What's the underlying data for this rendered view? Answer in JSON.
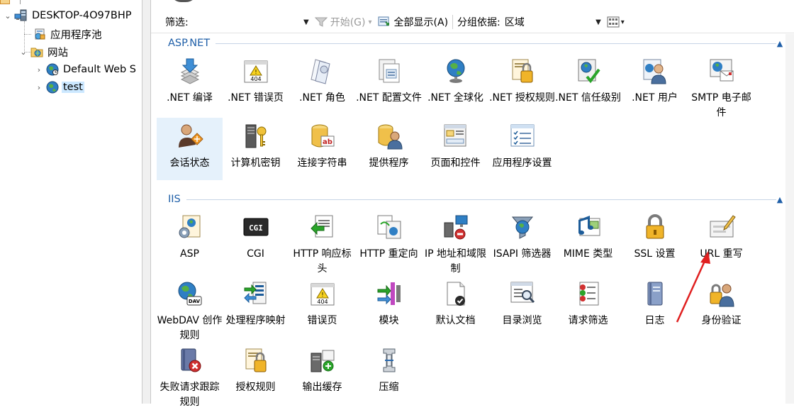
{
  "tree": {
    "items": [
      {
        "label": "DESKTOP-4O97BHP",
        "expanded": true
      },
      {
        "label": "应用程序池"
      },
      {
        "label": "网站",
        "expanded": true
      },
      {
        "label": "Default Web S"
      },
      {
        "label": "test",
        "selected": true
      }
    ]
  },
  "toolbar": {
    "filter_label": "筛选:",
    "filter_value": "",
    "go_label": "开始(G)",
    "show_all_label": "全部显示(A)",
    "group_by_label": "分组依据:",
    "group_by_value": "区域"
  },
  "sections": [
    {
      "title": "ASP.NET",
      "tiles": [
        {
          "label": ".NET 编译",
          "icon": "net-compile-icon"
        },
        {
          "label": ".NET 错误页",
          "icon": "net-error-pages-icon"
        },
        {
          "label": ".NET 角色",
          "icon": "net-roles-icon"
        },
        {
          "label": ".NET 配置文件",
          "icon": "net-profile-icon"
        },
        {
          "label": ".NET 全球化",
          "icon": "net-globalization-icon"
        },
        {
          "label": ".NET 授权规则",
          "icon": "net-authorization-icon"
        },
        {
          "label": ".NET 信任级别",
          "icon": "net-trust-levels-icon"
        },
        {
          "label": ".NET 用户",
          "icon": "net-users-icon"
        },
        {
          "label": "SMTP 电子邮件",
          "icon": "smtp-email-icon"
        },
        {
          "label": "会话状态",
          "icon": "session-state-icon",
          "selected": true
        },
        {
          "label": "计算机密钥",
          "icon": "machine-key-icon"
        },
        {
          "label": "连接字符串",
          "icon": "connection-strings-icon"
        },
        {
          "label": "提供程序",
          "icon": "providers-icon"
        },
        {
          "label": "页面和控件",
          "icon": "pages-controls-icon"
        },
        {
          "label": "应用程序设置",
          "icon": "app-settings-icon"
        }
      ]
    },
    {
      "title": "IIS",
      "tiles": [
        {
          "label": "ASP",
          "icon": "asp-icon"
        },
        {
          "label": "CGI",
          "icon": "cgi-icon"
        },
        {
          "label": "HTTP 响应标头",
          "icon": "http-response-headers-icon"
        },
        {
          "label": "HTTP 重定向",
          "icon": "http-redirect-icon"
        },
        {
          "label": "IP 地址和域限制",
          "icon": "ip-restrictions-icon"
        },
        {
          "label": "ISAPI 筛选器",
          "icon": "isapi-filters-icon"
        },
        {
          "label": "MIME 类型",
          "icon": "mime-types-icon"
        },
        {
          "label": "SSL 设置",
          "icon": "ssl-settings-icon"
        },
        {
          "label": "URL 重写",
          "icon": "url-rewrite-icon"
        },
        {
          "label": "WebDAV 创作规则",
          "icon": "webdav-icon"
        },
        {
          "label": "处理程序映射",
          "icon": "handler-mappings-icon"
        },
        {
          "label": "错误页",
          "icon": "error-pages-icon"
        },
        {
          "label": "模块",
          "icon": "modules-icon"
        },
        {
          "label": "默认文档",
          "icon": "default-document-icon"
        },
        {
          "label": "目录浏览",
          "icon": "directory-browsing-icon"
        },
        {
          "label": "请求筛选",
          "icon": "request-filtering-icon"
        },
        {
          "label": "日志",
          "icon": "logging-icon"
        },
        {
          "label": "身份验证",
          "icon": "authentication-icon"
        },
        {
          "label": "失败请求跟踪规则",
          "icon": "failed-request-tracing-icon"
        },
        {
          "label": "授权规则",
          "icon": "authorization-rules-icon"
        },
        {
          "label": "输出缓存",
          "icon": "output-caching-icon"
        },
        {
          "label": "压缩",
          "icon": "compression-icon"
        }
      ]
    }
  ],
  "colors": {
    "section_title": "#1f5fa8",
    "selection": "#e5f1fb",
    "annotation_arrow": "#e02020"
  }
}
